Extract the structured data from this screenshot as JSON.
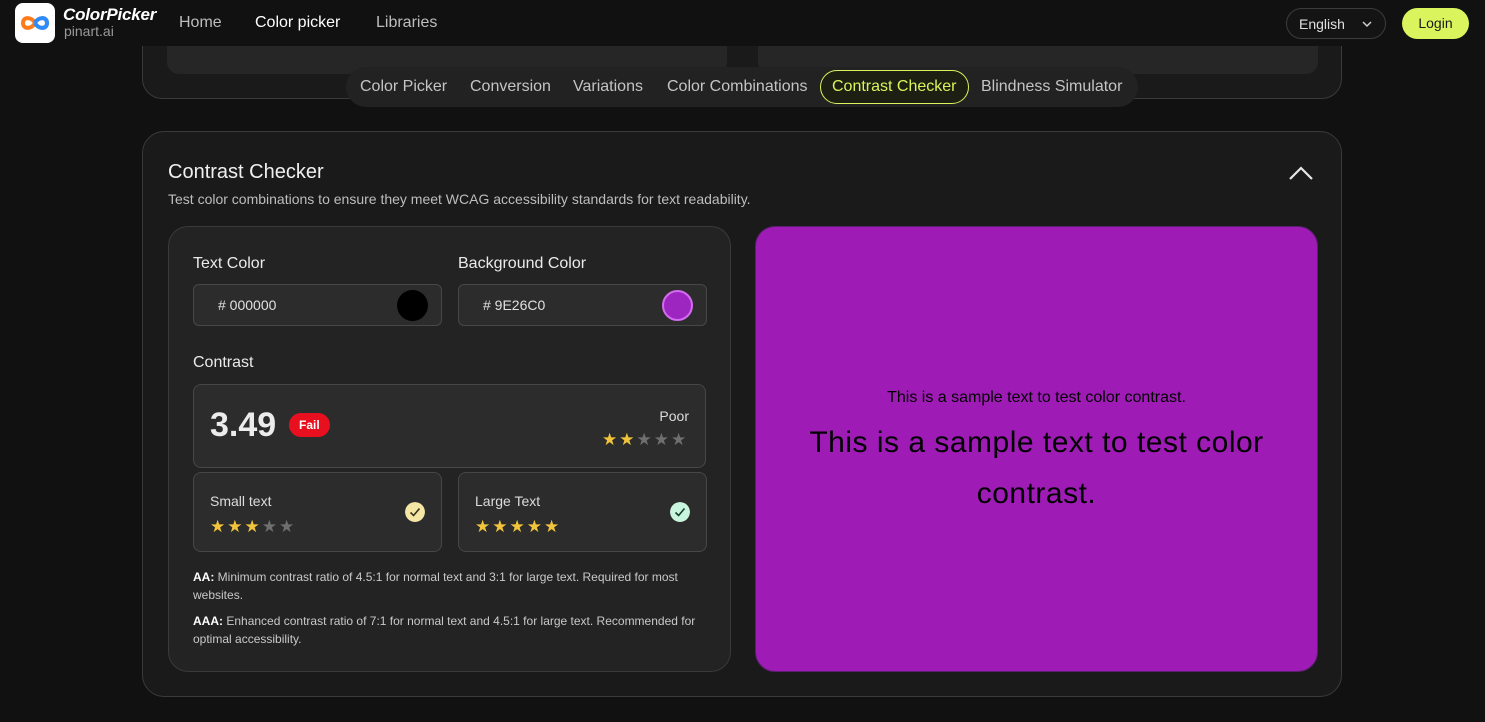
{
  "header": {
    "brand_name": "ColorPicker",
    "brand_sub": "pinart.ai",
    "nav": [
      "Home",
      "Color picker",
      "Libraries"
    ],
    "active_nav": "Color picker",
    "language": "English",
    "login_label": "Login",
    "accent_color": "#d9f45c"
  },
  "tabs": [
    "Color Picker",
    "Conversion",
    "Variations",
    "Color Combinations",
    "Contrast Checker",
    "Blindness Simulator"
  ],
  "active_tab": "Contrast Checker",
  "checker": {
    "title": "Contrast Checker",
    "description": "Test color combinations to ensure they meet WCAG accessibility standards for text readability.",
    "text_color": {
      "label": "Text Color",
      "value": "# 000000",
      "swatch": "#000000"
    },
    "background_color": {
      "label": "Background Color",
      "value": "# 9E26C0",
      "swatch": "#9E26C0"
    },
    "contrast": {
      "label": "Contrast",
      "ratio": "3.49",
      "badge": "Fail",
      "rating": "Poor",
      "stars": 2,
      "max_stars": 5
    },
    "small_text": {
      "label": "Small text",
      "stars": 3,
      "max_stars": 5,
      "check_color": "#f5e6a6"
    },
    "large_text": {
      "label": "Large Text",
      "stars": 5,
      "max_stars": 5,
      "check_color": "#c8f5dc"
    },
    "notes": {
      "aa_label": "AA:",
      "aa_text": "Minimum contrast ratio of 4.5:1 for normal text and 3:1 for large text. Required for most websites.",
      "aaa_label": "AAA:",
      "aaa_text": "Enhanced contrast ratio of 7:1 for normal text and 4.5:1 for large text. Recommended for optimal accessibility."
    },
    "preview": {
      "small_text": "This is a sample text to test color contrast.",
      "large_text": "This is a sample text to test color contrast.",
      "background": "#9E1CB5",
      "text_color": "#000000"
    }
  }
}
